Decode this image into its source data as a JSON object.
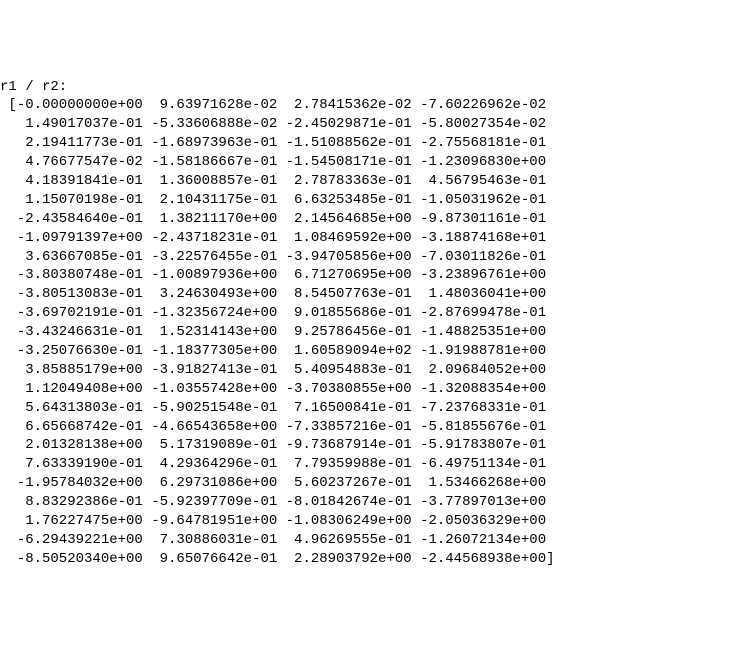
{
  "header_label": "r1 / r2:",
  "open_bracket": " [",
  "rows": [
    [
      "-0.00000000e+00",
      "9.63971628e-02",
      "2.78415362e-02",
      "-7.60226962e-02"
    ],
    [
      "1.49017037e-01",
      "-5.33606888e-02",
      "-2.45029871e-01",
      "-5.80027354e-02"
    ],
    [
      "2.19411773e-01",
      "-1.68973963e-01",
      "-1.51088562e-01",
      "-2.75568181e-01"
    ],
    [
      "4.76677547e-02",
      "-1.58186667e-01",
      "-1.54508171e-01",
      "-1.23096830e+00"
    ],
    [
      "4.18391841e-01",
      "1.36008857e-01",
      "2.78783363e-01",
      "4.56795463e-01"
    ],
    [
      "1.15070198e-01",
      "2.10431175e-01",
      "6.63253485e-01",
      "-1.05031962e-01"
    ],
    [
      "-2.43584640e-01",
      "1.38211170e+00",
      "2.14564685e+00",
      "-9.87301161e-01"
    ],
    [
      "-1.09791397e+00",
      "-2.43718231e-01",
      "1.08469592e+00",
      "-3.18874168e+01"
    ],
    [
      "3.63667085e-01",
      "-3.22576455e-01",
      "-3.94705856e+00",
      "-7.03011826e-01"
    ],
    [
      "-3.80380748e-01",
      "-1.00897936e+00",
      "6.71270695e+00",
      "-3.23896761e+00"
    ],
    [
      "-3.80513083e-01",
      "3.24630493e+00",
      "8.54507763e-01",
      "1.48036041e+00"
    ],
    [
      "-3.69702191e-01",
      "-1.32356724e+00",
      "9.01855686e-01",
      "-2.87699478e-01"
    ],
    [
      "-3.43246631e-01",
      "1.52314143e+00",
      "9.25786456e-01",
      "-1.48825351e+00"
    ],
    [
      "-3.25076630e-01",
      "-1.18377305e+00",
      "1.60589094e+02",
      "-1.91988781e+00"
    ],
    [
      "3.85885179e+00",
      "-3.91827413e-01",
      "5.40954883e-01",
      "2.09684052e+00"
    ],
    [
      "1.12049408e+00",
      "-1.03557428e+00",
      "-3.70380855e+00",
      "-1.32088354e+00"
    ],
    [
      "5.64313803e-01",
      "-5.90251548e-01",
      "7.16500841e-01",
      "-7.23768331e-01"
    ],
    [
      "6.65668742e-01",
      "-4.66543658e+00",
      "-7.33857216e-01",
      "-5.81855676e-01"
    ],
    [
      "2.01328138e+00",
      "5.17319089e-01",
      "-9.73687914e-01",
      "-5.91783807e-01"
    ],
    [
      "7.63339190e-01",
      "4.29364296e-01",
      "7.79359988e-01",
      "-6.49751134e-01"
    ],
    [
      "-1.95784032e+00",
      "6.29731086e+00",
      "5.60237267e-01",
      "1.53466268e+00"
    ],
    [
      "8.83292386e-01",
      "-5.92397709e-01",
      "-8.01842674e-01",
      "-3.77897013e+00"
    ],
    [
      "1.76227475e+00",
      "-9.64781951e+00",
      "-1.08306249e+00",
      "-2.05036329e+00"
    ],
    [
      "-6.29439221e+00",
      "7.30886031e-01",
      "4.96269555e-01",
      "-1.26072134e+00"
    ],
    [
      "-8.50520340e+00",
      "9.65076642e-01",
      "2.28903792e+00",
      "-2.44568938e+00"
    ]
  ],
  "trailing_close": "]"
}
